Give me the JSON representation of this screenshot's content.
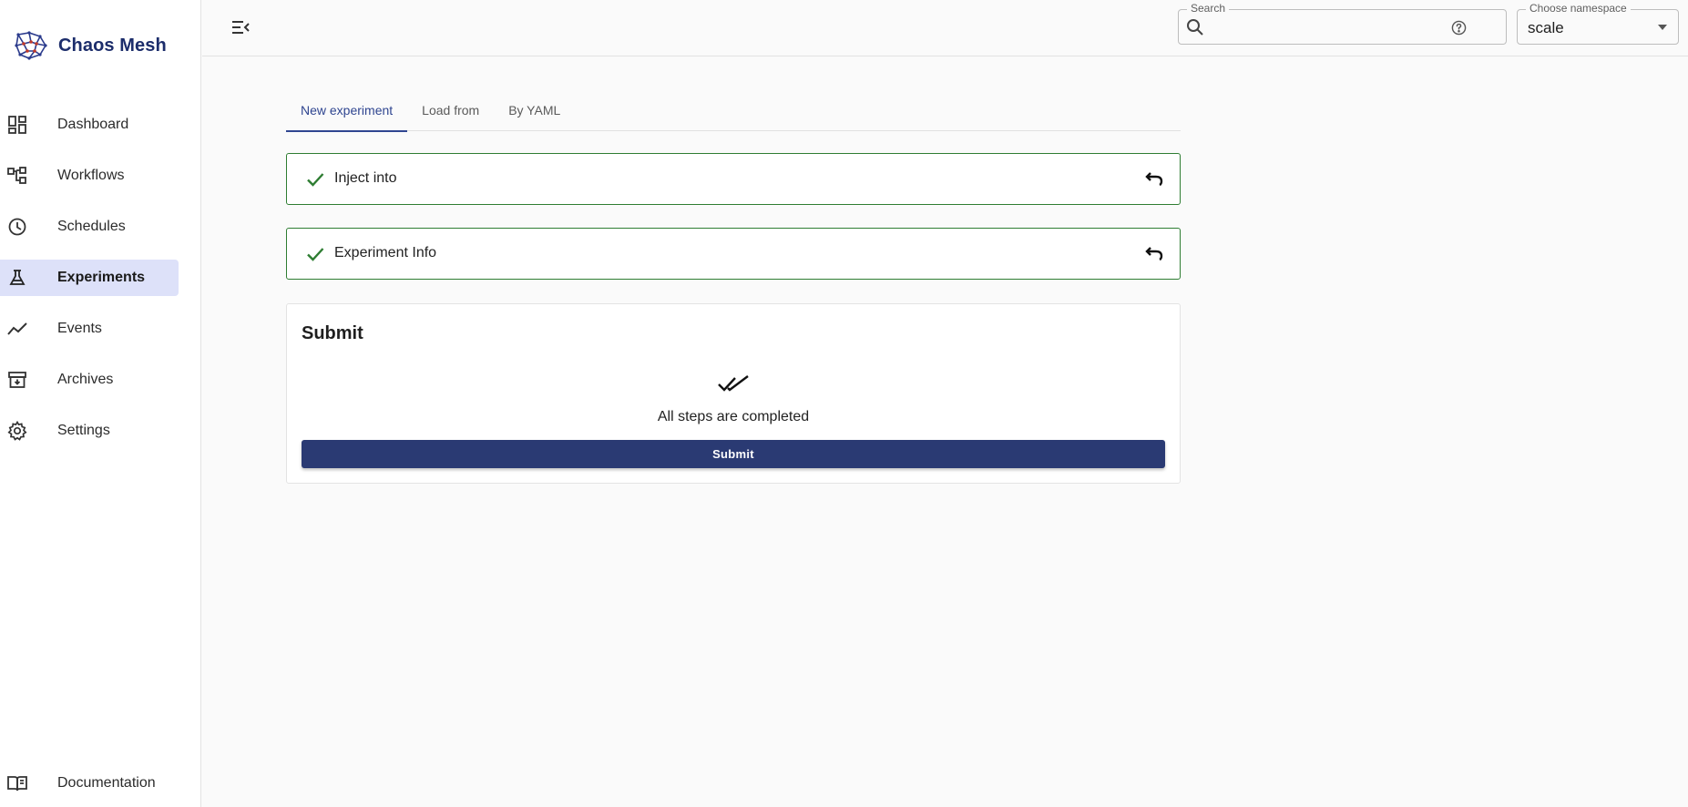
{
  "brand": {
    "name": "Chaos Mesh"
  },
  "sidebar": {
    "items": [
      {
        "label": "Dashboard",
        "icon": "dashboard-icon"
      },
      {
        "label": "Workflows",
        "icon": "workflow-icon"
      },
      {
        "label": "Schedules",
        "icon": "clock-icon"
      },
      {
        "label": "Experiments",
        "icon": "flask-icon",
        "active": true
      },
      {
        "label": "Events",
        "icon": "trend-icon"
      },
      {
        "label": "Archives",
        "icon": "archive-icon"
      },
      {
        "label": "Settings",
        "icon": "gear-icon"
      }
    ],
    "documentation": {
      "label": "Documentation",
      "icon": "book-icon"
    }
  },
  "topbar": {
    "search": {
      "label": "Search",
      "value": "",
      "placeholder": ""
    },
    "namespace": {
      "label": "Choose namespace",
      "value": "scale"
    }
  },
  "tabs": [
    {
      "label": "New experiment",
      "active": true
    },
    {
      "label": "Load from"
    },
    {
      "label": "By YAML"
    }
  ],
  "steps": [
    {
      "label": "Inject into",
      "status": "completed"
    },
    {
      "label": "Experiment Info",
      "status": "completed"
    }
  ],
  "submit": {
    "title": "Submit",
    "message": "All steps are completed",
    "button_label": "Submit"
  },
  "colors": {
    "accent": "#2f4590",
    "success": "#2e7d32",
    "active_nav_bg": "#dde1f9",
    "brand_text": "#1c2d6b"
  }
}
